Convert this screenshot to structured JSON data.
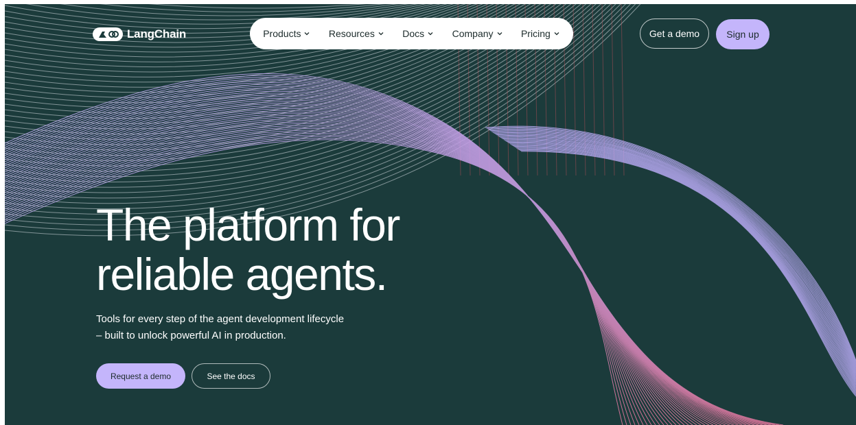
{
  "brand": {
    "name": "LangChain",
    "logo_icon": "parrot-link-icon"
  },
  "nav": {
    "items": [
      {
        "label": "Products"
      },
      {
        "label": "Resources"
      },
      {
        "label": "Docs"
      },
      {
        "label": "Company"
      },
      {
        "label": "Pricing"
      }
    ]
  },
  "header_actions": {
    "demo_label": "Get a demo",
    "signup_label": "Sign up"
  },
  "hero": {
    "headline_line1": "The platform for",
    "headline_line2": "reliable agents.",
    "subtitle_line1": "Tools for every step of the agent development lifecycle",
    "subtitle_line2": "– built to unlock powerful AI in production.",
    "cta_primary": "Request a demo",
    "cta_secondary": "See the docs"
  },
  "colors": {
    "background": "#1b3b3b",
    "accent": "#c4b5fb",
    "line_lilac": "#b7a9f2",
    "line_pink": "#e0759a",
    "line_red": "#c0505a"
  }
}
